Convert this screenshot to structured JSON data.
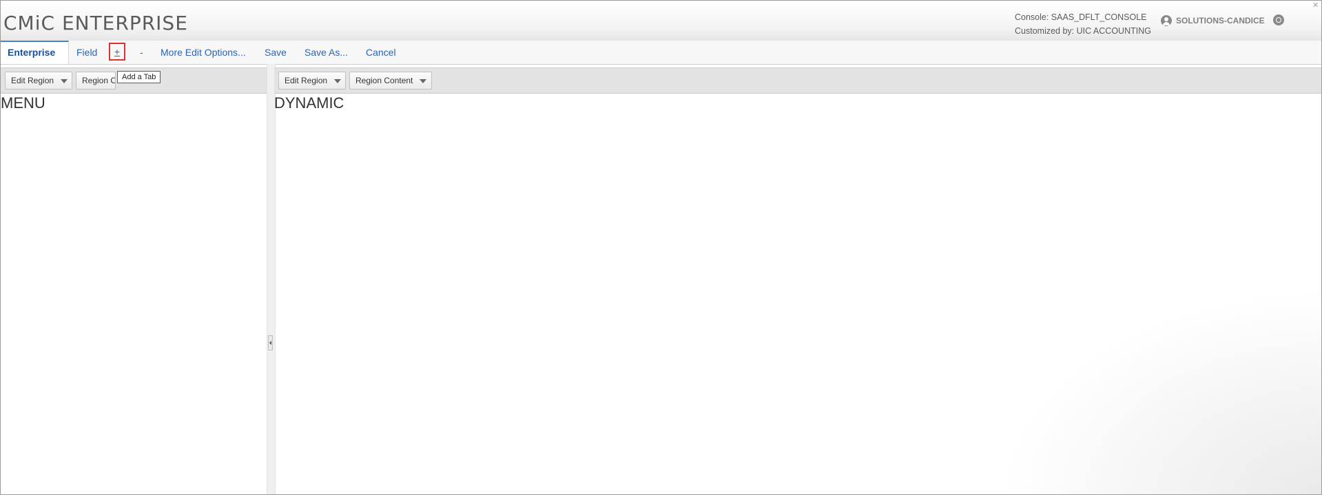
{
  "header": {
    "app_title": "CMiC ENTERPRISE",
    "console_label": "Console: SAAS_DFLT_CONSOLE",
    "customized_by": "Customized by: UIC ACCOUNTING",
    "user_name": "SOLUTIONS-CANDICE",
    "close_glyph": "✕"
  },
  "tabs": {
    "enterprise": "Enterprise",
    "field": "Field",
    "add_tab": "+",
    "remove_tab": "-",
    "more_edit_options": "More Edit Options...",
    "save": "Save",
    "save_as": "Save As...",
    "cancel": "Cancel"
  },
  "tooltip": "Add a Tab",
  "left_panel": {
    "edit_region": "Edit Region",
    "region_content": "Region Content",
    "title": "MENU"
  },
  "right_panel": {
    "edit_region": "Edit Region",
    "region_content": "Region Content",
    "title": "DYNAMIC"
  },
  "colors": {
    "accent": "#2a63b5",
    "highlight_box": "#e03030"
  },
  "icons": [
    "user-icon",
    "help-icon",
    "close-icon",
    "chevron-down-icon",
    "collapse-left-icon"
  ]
}
